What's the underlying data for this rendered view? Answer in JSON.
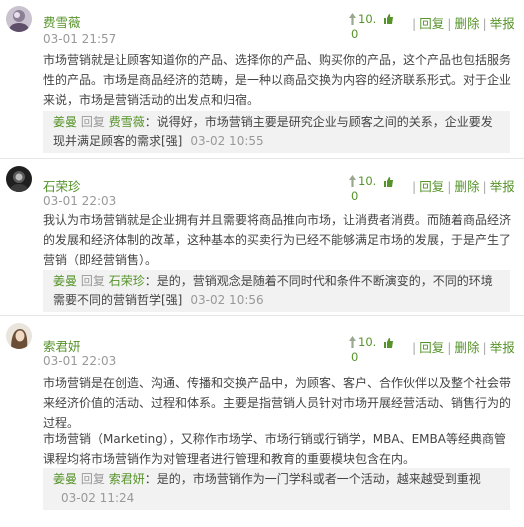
{
  "comments": [
    {
      "author": "费雪薇",
      "date": "03-01 21:57",
      "vote_line1": "10.",
      "vote_line2": "0",
      "reply_label": "回复",
      "delete_label": "删除",
      "report_label": "举报",
      "content": "市场营销就是让顾客知道你的产品、选择你的产品、购买你的产品，这个产品也包括服务性的产品。市场是商品经济的范畴，是一种以商品交换为内容的经济联系形式。对于企业来说，市场是营销活动的出发点和归宿。",
      "sub_reply": {
        "author": "姜曼",
        "label": "回复",
        "target": "费雪薇",
        "text": "：说得好，市场营销主要是研究企业与顾客之间的关系，企业要发现并满足顾客的需求[强]",
        "time": "03-02 10:55"
      }
    },
    {
      "author": "石荣珍",
      "date": "03-01 22:03",
      "vote_line1": "10.",
      "vote_line2": "0",
      "reply_label": "回复",
      "delete_label": "删除",
      "report_label": "举报",
      "content": "我认为市场营销就是企业拥有并且需要将商品推向市场，让消费者消费。而随着商品经济的发展和经济体制的改革，这种基本的买卖行为已经不能够满足市场的发展，于是产生了营销（即经营销售）。",
      "sub_reply": {
        "author": "姜曼",
        "label": "回复",
        "target": "石荣珍",
        "text": "：是的，营销观念是随着不同时代和条件不断演变的，不同的环境需要不同的营销哲学[强]",
        "time": "03-02 10:56"
      }
    },
    {
      "author": "索君妍",
      "date": "03-01 22:03",
      "vote_line1": "10.",
      "vote_line2": "0",
      "reply_label": "回复",
      "delete_label": "删除",
      "report_label": "举报",
      "content": "市场营销是在创造、沟通、传播和交换产品中，为顾客、客户、合作伙伴以及整个社会带来经济价值的活动、过程和体系。主要是指营销人员针对市场开展经营活动、销售行为的过程。",
      "content2": "市场营销（Marketing），又称作市场学、市场行销或行销学，MBA、EMBA等经典商管课程均将市场营销作为对管理者进行管理和教育的重要模块包含在内。",
      "sub_reply": {
        "author": "姜曼",
        "label": "回复",
        "target": "索君妍",
        "text": "：是的，市场营销作为一门学科或者一个活动，越来越受到重视",
        "time": "03-02 11:24"
      }
    }
  ],
  "colors": {
    "accent_green": "#56932a",
    "muted_gray": "#999999",
    "reply_bg": "#f2f2f2",
    "divider": "#e6e6e6"
  },
  "icons": {
    "vote": "upvote-arrow-icon",
    "thumb": "thumbs-up-icon"
  }
}
